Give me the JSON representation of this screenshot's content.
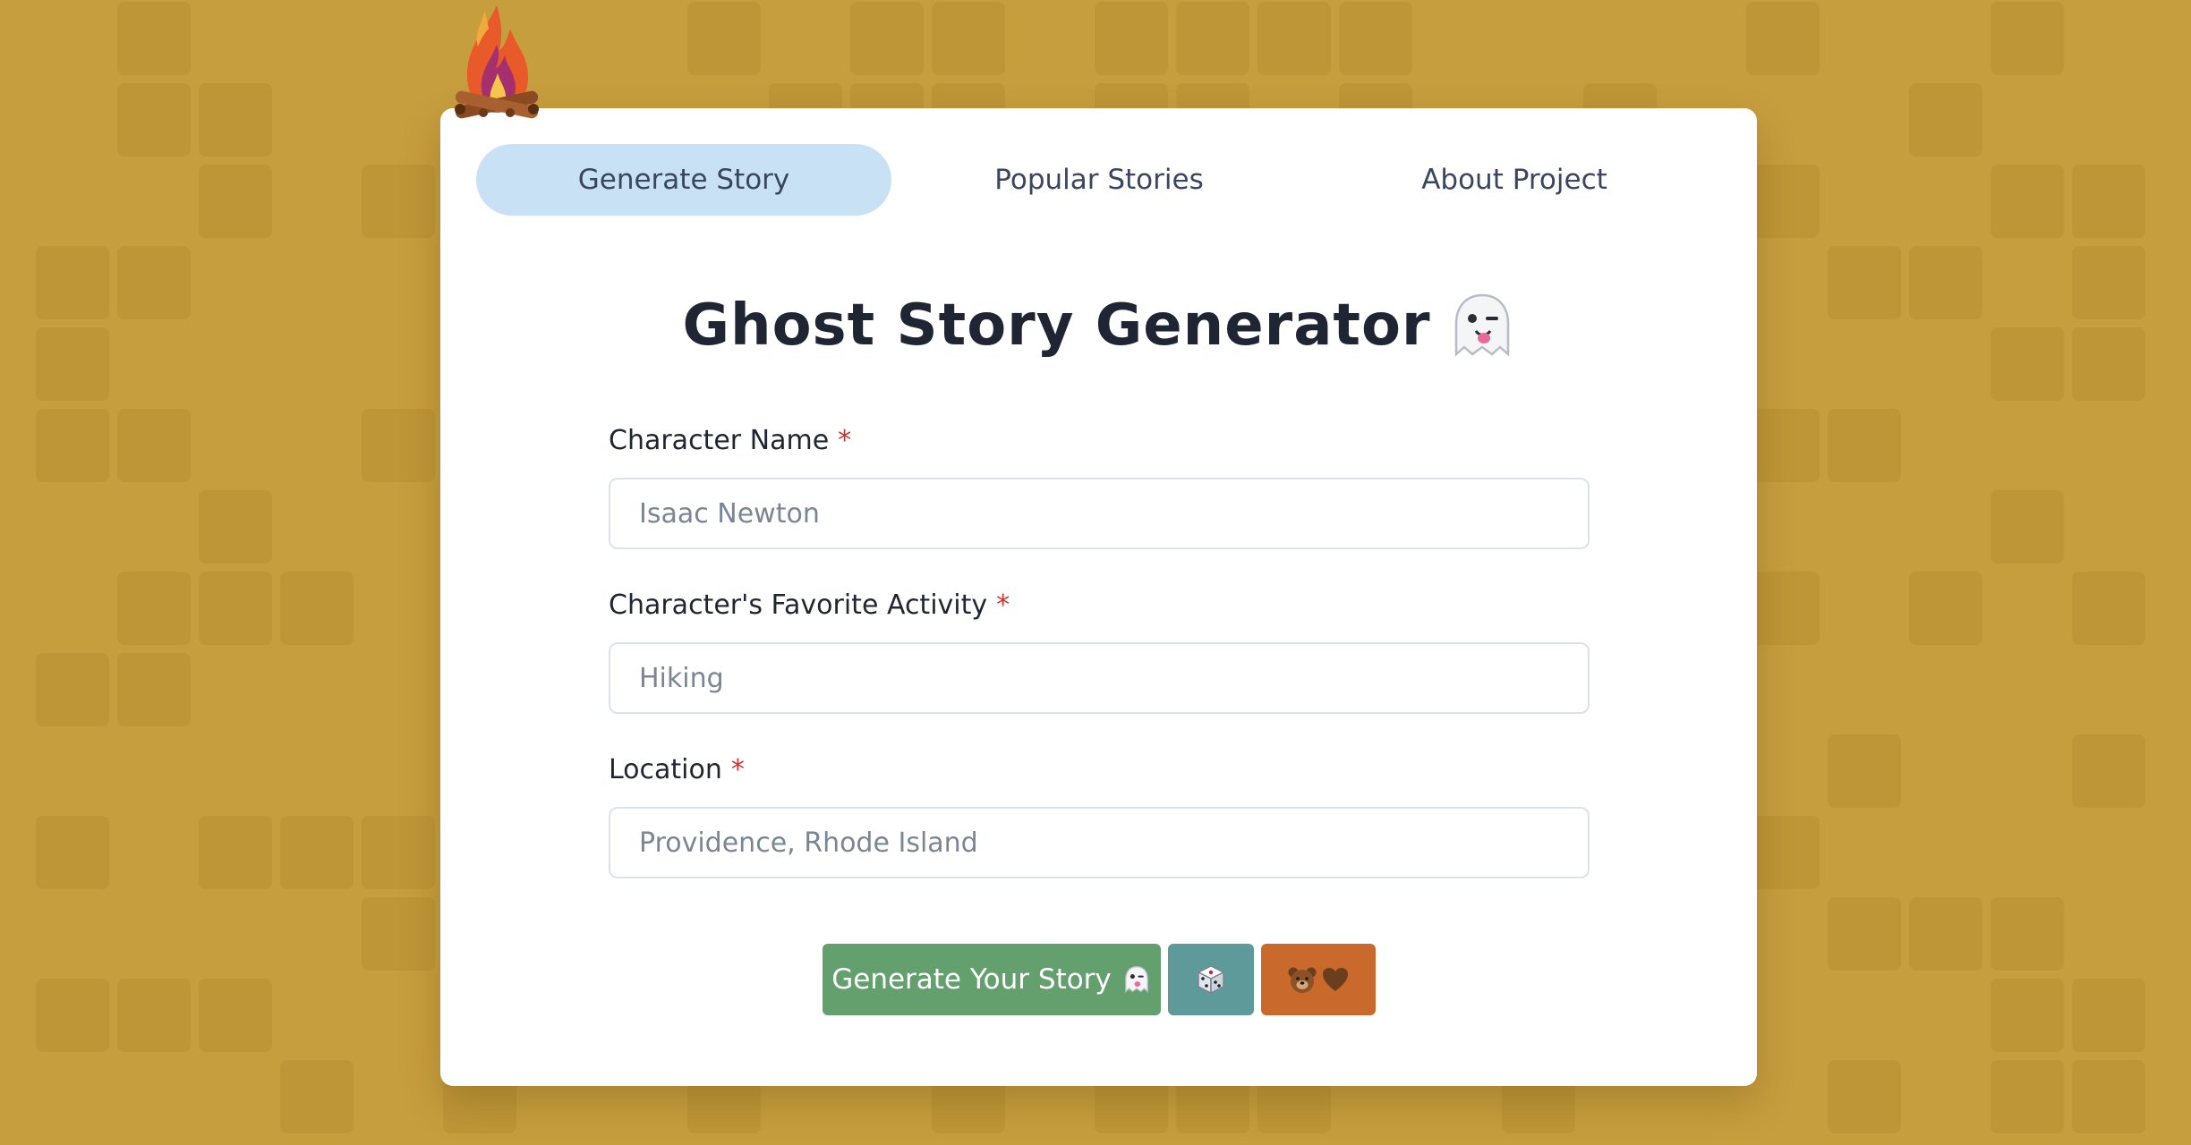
{
  "tabs": [
    {
      "label": "Generate Story",
      "active": true
    },
    {
      "label": "Popular Stories",
      "active": false
    },
    {
      "label": "About Project",
      "active": false
    }
  ],
  "title": {
    "text": "Ghost Story Generator",
    "icon": "ghost-icon"
  },
  "form": {
    "required_marker": "*",
    "fields": [
      {
        "label": "Character Name",
        "placeholder": "Isaac Newton",
        "value": ""
      },
      {
        "label": "Character's Favorite Activity",
        "placeholder": "Hiking",
        "value": ""
      },
      {
        "label": "Location",
        "placeholder": "Providence, Rhode Island",
        "value": ""
      }
    ]
  },
  "buttons": {
    "generate_label": "Generate Your Story",
    "generate_icon": "ghost-icon",
    "random_icon": "dice-icon",
    "bear_icons": [
      "bear-icon",
      "brown-heart-icon"
    ]
  },
  "decoration": {
    "logo_icon": "campfire-icon"
  },
  "colors": {
    "background": "#c79e3e",
    "card": "#ffffff",
    "active_tab": "#c9e1f5",
    "text": "#1f2533",
    "required": "#d03030",
    "generate_button": "#64a06e",
    "dice_button": "#5f9a9a",
    "bear_button": "#c96a2c"
  }
}
